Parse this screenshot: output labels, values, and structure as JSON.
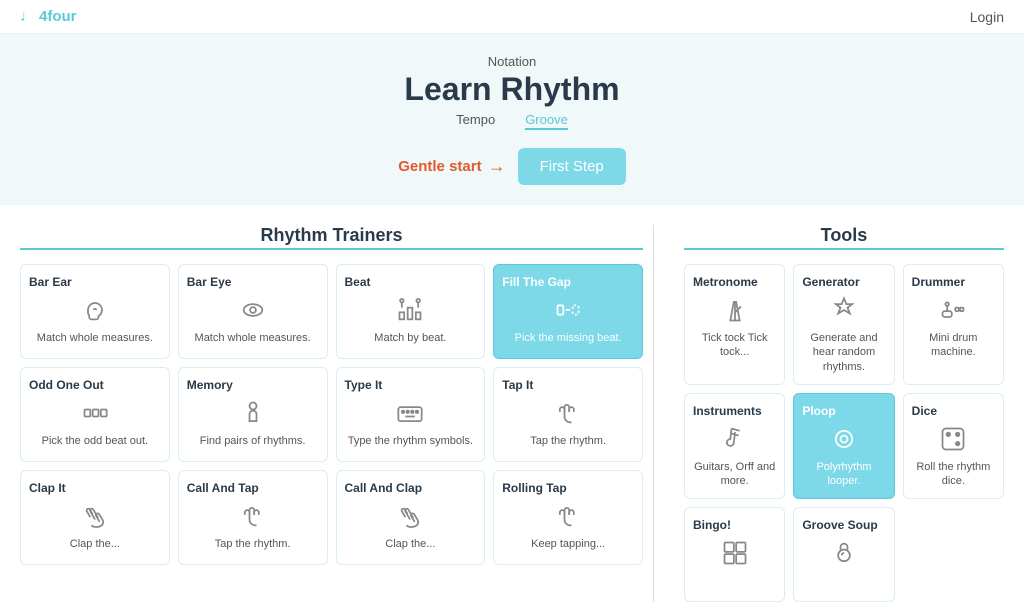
{
  "header": {
    "logo": "4four",
    "login": "Login"
  },
  "hero": {
    "notation_label": "Notation",
    "title": "Learn Rhythm",
    "tempo_label": "Tempo",
    "groove_label": "Groove",
    "gentle_start": "Gentle start",
    "first_step": "First Step"
  },
  "rhythm_section": {
    "title": "Rhythm Trainers",
    "items": [
      {
        "id": "bar-ear",
        "title": "Bar Ear",
        "icon": "ear",
        "desc": "Match whole measures."
      },
      {
        "id": "bar-eye",
        "title": "Bar Eye",
        "icon": "eye",
        "desc": "Match whole measures."
      },
      {
        "id": "beat",
        "title": "Beat",
        "icon": "beats",
        "desc": "Match by beat."
      },
      {
        "id": "fill-the-gap",
        "title": "Fill The Gap",
        "icon": "gap",
        "desc": "Pick the missing beat.",
        "highlighted": true
      },
      {
        "id": "odd-one-out",
        "title": "Odd One Out",
        "icon": "odd",
        "desc": "Pick the odd beat out."
      },
      {
        "id": "memory",
        "title": "Memory",
        "icon": "memory",
        "desc": "Find pairs of rhythms."
      },
      {
        "id": "type-it",
        "title": "Type It",
        "icon": "keyboard",
        "desc": "Type the rhythm symbols."
      },
      {
        "id": "tap-it",
        "title": "Tap It",
        "icon": "tap",
        "desc": "Tap the rhythm."
      },
      {
        "id": "clap-it",
        "title": "Clap It",
        "icon": "clap",
        "desc": "Clap the..."
      },
      {
        "id": "call-and-tap",
        "title": "Call And Tap",
        "icon": "call-tap",
        "desc": "Tap the rhythm."
      },
      {
        "id": "call-and-clap",
        "title": "Call And Clap",
        "icon": "call-clap",
        "desc": "Clap the..."
      },
      {
        "id": "rolling-tap",
        "title": "Rolling Tap",
        "icon": "rolling",
        "desc": "Keep tapping..."
      }
    ]
  },
  "tools_section": {
    "title": "Tools",
    "items": [
      {
        "id": "metronome",
        "title": "Metronome",
        "icon": "metronome",
        "desc": "Tick tock Tick tock..."
      },
      {
        "id": "generator",
        "title": "Generator",
        "icon": "generator",
        "desc": "Generate and hear random rhythms."
      },
      {
        "id": "drummer",
        "title": "Drummer",
        "icon": "drummer",
        "desc": "Mini drum machine."
      },
      {
        "id": "instruments",
        "title": "Instruments",
        "icon": "instruments",
        "desc": "Guitars, Orff and more."
      },
      {
        "id": "ploop",
        "title": "Ploop",
        "icon": "ploop",
        "desc": "Polyrhythm looper.",
        "highlighted": true
      },
      {
        "id": "dice",
        "title": "Dice",
        "icon": "dice",
        "desc": "Roll the rhythm dice."
      },
      {
        "id": "bingo",
        "title": "Bingo!",
        "icon": "bingo",
        "desc": ""
      },
      {
        "id": "groove-soup",
        "title": "Groove Soup",
        "icon": "groove-soup",
        "desc": ""
      }
    ]
  }
}
